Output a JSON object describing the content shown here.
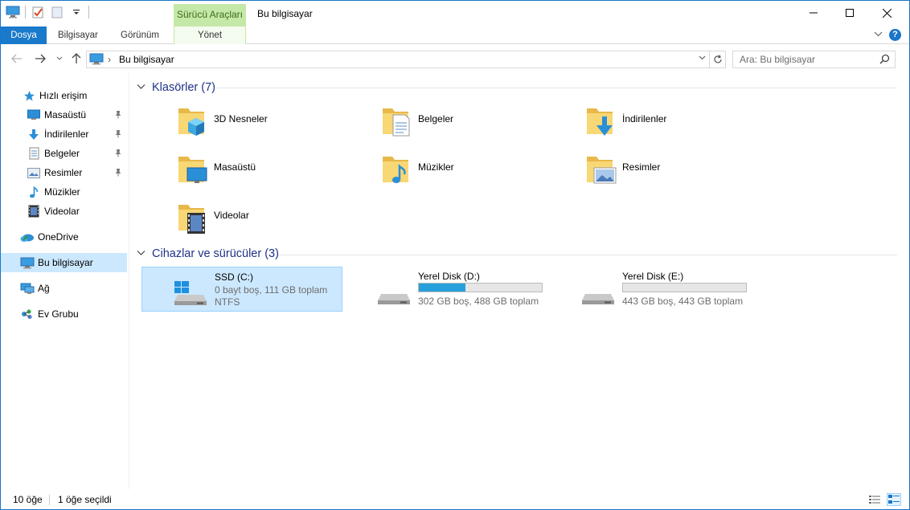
{
  "window": {
    "title": "Bu bilgisayar",
    "tool_tab": "Sürücü Araçları"
  },
  "ribbon": {
    "tabs": [
      {
        "label": "Dosya"
      },
      {
        "label": "Bilgisayar"
      },
      {
        "label": "Görünüm"
      },
      {
        "label": "Yönet"
      }
    ]
  },
  "address": {
    "path": "Bu bilgisayar",
    "search_placeholder": "Ara: Bu bilgisayar"
  },
  "nav": {
    "items": [
      {
        "label": "Hızlı erişim",
        "icon": "star-icon"
      },
      {
        "label": "Masaüstü",
        "icon": "desktop-icon",
        "pinned": true
      },
      {
        "label": "İndirilenler",
        "icon": "download-icon",
        "pinned": true
      },
      {
        "label": "Belgeler",
        "icon": "document-icon",
        "pinned": true
      },
      {
        "label": "Resimler",
        "icon": "pictures-icon",
        "pinned": true
      },
      {
        "label": "Müzikler",
        "icon": "music-icon"
      },
      {
        "label": "Videolar",
        "icon": "video-icon"
      },
      {
        "label": "OneDrive",
        "icon": "onedrive-icon"
      },
      {
        "label": "Bu bilgisayar",
        "icon": "computer-icon",
        "selected": true
      },
      {
        "label": "Ağ",
        "icon": "network-icon"
      },
      {
        "label": "Ev Grubu",
        "icon": "homegroup-icon"
      }
    ]
  },
  "content": {
    "folders_header": "Klasörler (7)",
    "devices_header": "Cihazlar ve sürücüler (3)",
    "folders": [
      {
        "label": "3D Nesneler",
        "icon": "3d-objects-folder-icon"
      },
      {
        "label": "Belgeler",
        "icon": "documents-folder-icon"
      },
      {
        "label": "İndirilenler",
        "icon": "downloads-folder-icon"
      },
      {
        "label": "Masaüstü",
        "icon": "desktop-folder-icon"
      },
      {
        "label": "Müzikler",
        "icon": "music-folder-icon"
      },
      {
        "label": "Resimler",
        "icon": "pictures-folder-icon"
      },
      {
        "label": "Videolar",
        "icon": "videos-folder-icon"
      }
    ],
    "drives": [
      {
        "name": "SSD (C:)",
        "info": "0 bayt boş, 111 GB toplam",
        "fs": "NTFS",
        "selected": true
      },
      {
        "name": "Yerel Disk (D:)",
        "info": "302 GB boş, 488 GB toplam",
        "used_fraction": 0.38
      },
      {
        "name": "Yerel Disk (E:)",
        "info": "443 GB boş, 443 GB toplam",
        "used_fraction": 0.0
      }
    ]
  },
  "status": {
    "item_count": "10 öğe",
    "selected_count": "1 öğe seçildi"
  },
  "colors": {
    "accent": "#1979ca",
    "selection": "#cce8ff",
    "tool_tab": "#c4e8a8",
    "group_header": "#1e3287",
    "drive_bar": "#26a0da"
  }
}
